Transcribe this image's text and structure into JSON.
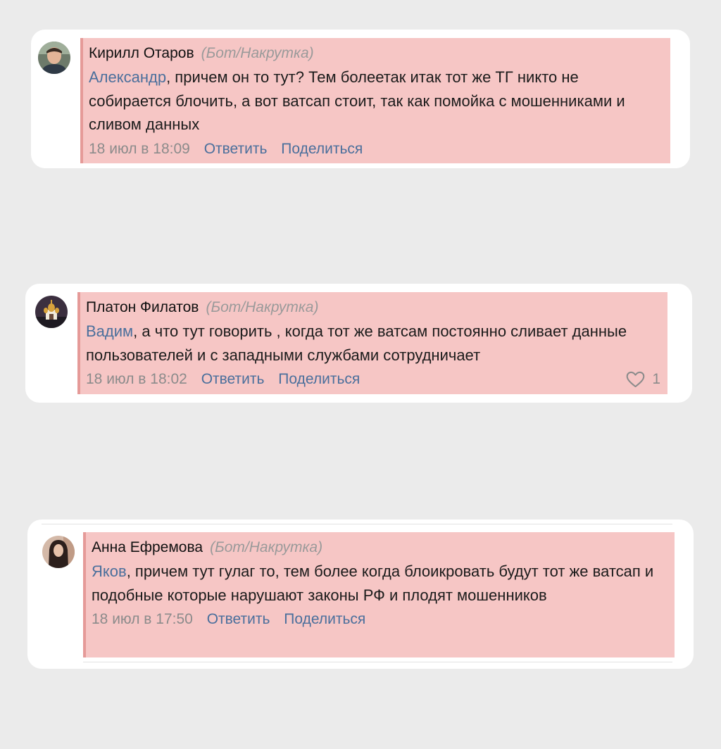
{
  "comments": [
    {
      "author": "Кирилл Отаров",
      "tag": "(Бот/Накрутка)",
      "mention": "Александр",
      "text": ", причем он то тут? Тем болеетак итак тот же ТГ никто не собирается блочить, а вот ватсап стоит, так как помойка с мошенниками и сливом данных",
      "date": "18 июл в 18:09",
      "reply_label": "Ответить",
      "share_label": "Поделиться"
    },
    {
      "author": "Платон Филатов",
      "tag": "(Бот/Накрутка)",
      "mention": "Вадим",
      "text": ", а что тут говорить , когда тот же ватсам постоянно сливает данные пользователей и с западными службами сотрудничает",
      "date": "18 июл в 18:02",
      "reply_label": "Ответить",
      "share_label": "Поделиться",
      "likes": "1"
    },
    {
      "author": "Анна Ефремова",
      "tag": "(Бот/Накрутка)",
      "mention": "Яков",
      "text": ", причем тут гулаг то, тем более когда блоикровать будут тот же ватсап и подобные которые нарушают законы РФ и плодят мошенников",
      "date": "18 июл в 17:50",
      "reply_label": "Ответить",
      "share_label": "Поделиться"
    }
  ],
  "colors": {
    "background": "#ebebeb",
    "highlight": "#f6c6c5",
    "highlight_border": "#e59a98",
    "link": "#4a6f9c",
    "muted": "#8b8b8b"
  }
}
